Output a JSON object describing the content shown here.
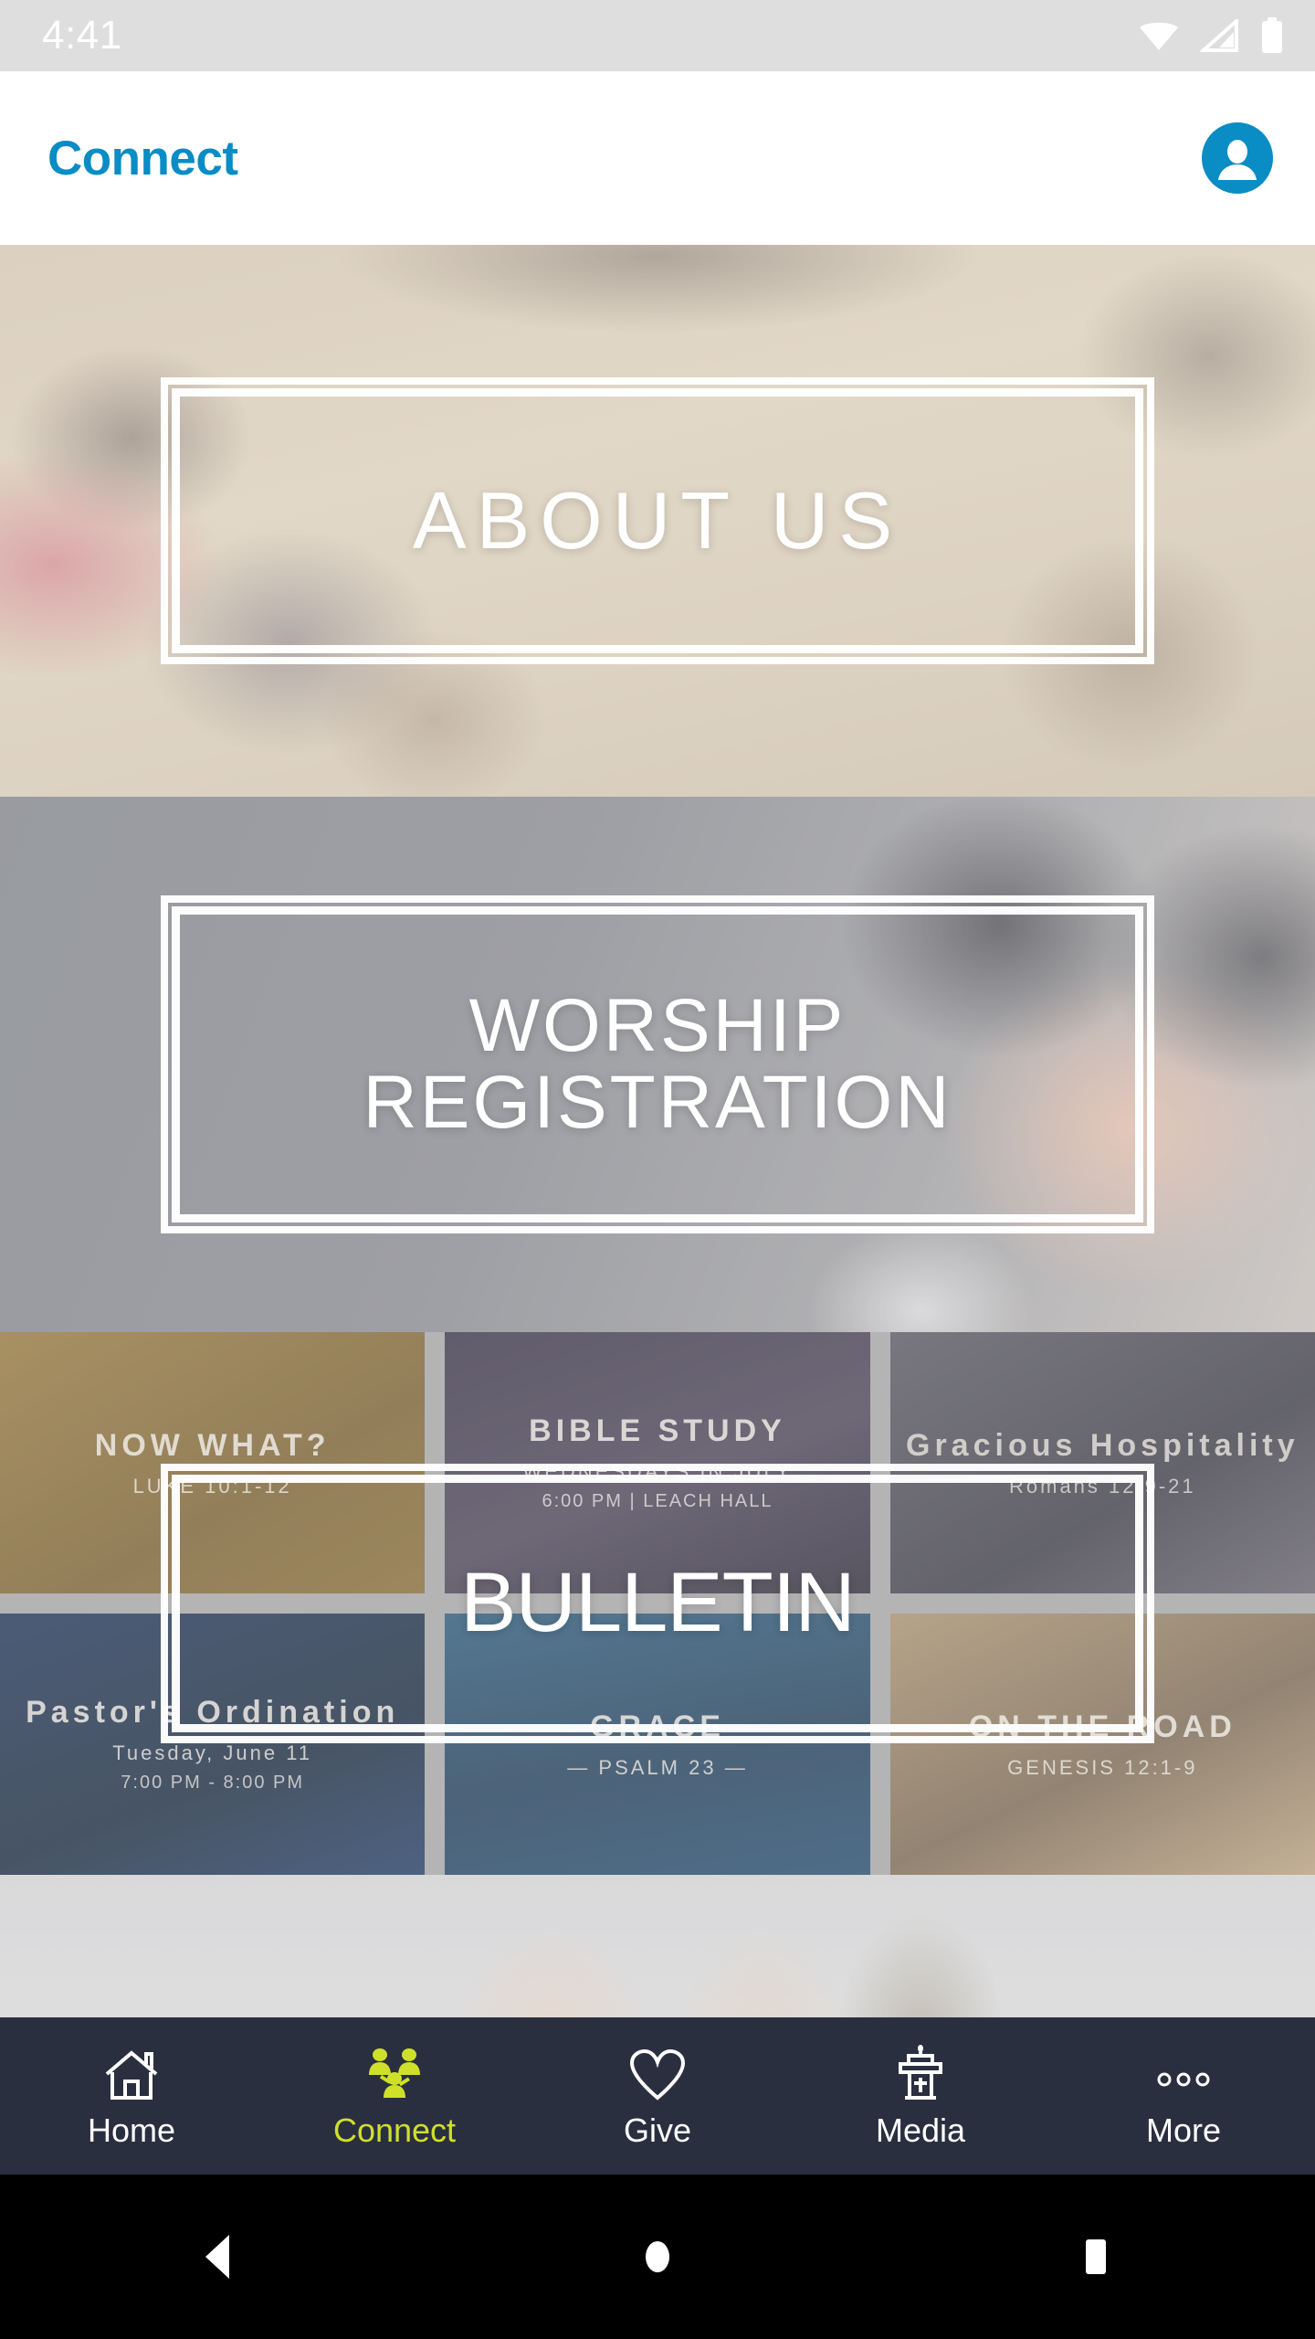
{
  "status_bar": {
    "time": "4:41",
    "icons": [
      "wifi-icon",
      "cellular-signal-icon",
      "battery-icon"
    ]
  },
  "app_bar": {
    "title": "Connect",
    "accent_color": "#0a8cc4",
    "account_icon": "account-circle-icon"
  },
  "cards": [
    {
      "id": "about",
      "label": "ABOUT US"
    },
    {
      "id": "worship",
      "label_line1": "WORSHIP",
      "label_line2": "REGISTRATION"
    },
    {
      "id": "bulletin",
      "label": "BULLETIN"
    }
  ],
  "collage_tiles": [
    {
      "title": "NOW WHAT?",
      "subtitle": "LUKE 10:1-12",
      "detail": ""
    },
    {
      "title": "BIBLE STUDY",
      "subtitle": "WEDNESDAYS IN JULY",
      "detail": "6:00 PM | LEACH HALL"
    },
    {
      "title": "Gracious Hospitality",
      "subtitle": "Romans 12:9-21",
      "detail": ""
    },
    {
      "title": "Pastor's Ordination",
      "subtitle": "Tuesday, June 11",
      "detail": "7:00 PM - 8:00 PM"
    },
    {
      "title": "GRACE",
      "subtitle": "— PSALM 23 —",
      "detail": ""
    },
    {
      "title": "ON THE ROAD",
      "subtitle": "GENESIS 12:1-9",
      "detail": ""
    }
  ],
  "tab_bar": {
    "background_color": "#2a2f40",
    "active_color": "#cfe02a",
    "inactive_color": "#ffffff",
    "items": [
      {
        "label": "Home",
        "icon": "home-icon",
        "active": false
      },
      {
        "label": "Connect",
        "icon": "people-group-icon",
        "active": true
      },
      {
        "label": "Give",
        "icon": "heart-icon",
        "active": false
      },
      {
        "label": "Media",
        "icon": "pulpit-icon",
        "active": false
      },
      {
        "label": "More",
        "icon": "more-dots-icon",
        "active": false
      }
    ]
  },
  "android_nav": {
    "buttons": [
      {
        "name": "back-button",
        "icon": "triangle-left-icon"
      },
      {
        "name": "home-button",
        "icon": "circle-icon"
      },
      {
        "name": "recents-button",
        "icon": "square-icon"
      }
    ]
  }
}
